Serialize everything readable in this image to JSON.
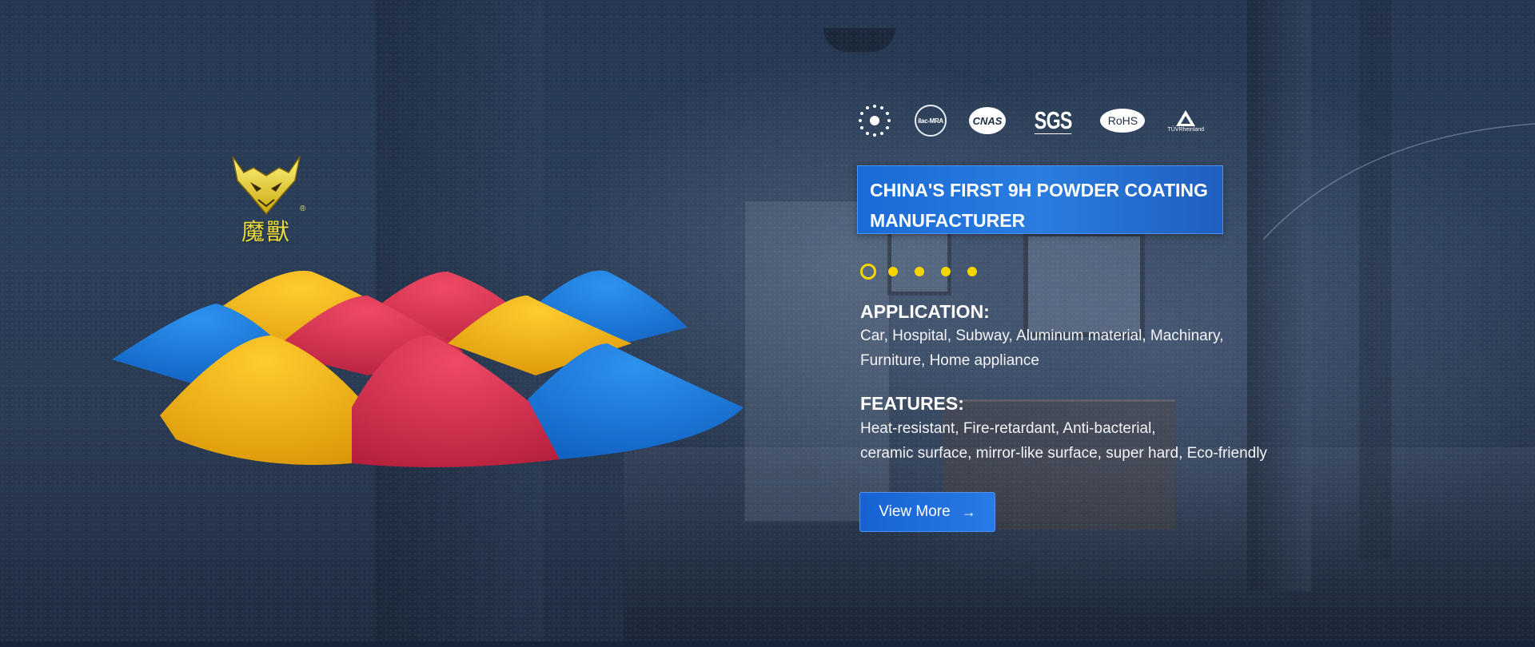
{
  "brand": {
    "chinese_name": "魔獸",
    "registered_mark": "®"
  },
  "certifications": [
    {
      "icon": "eu-stars-cert-icon",
      "label": ""
    },
    {
      "icon": "ilac-mra-cert-icon",
      "label": "ilac-MRA"
    },
    {
      "icon": "cnas-cert-icon",
      "label": "CNAS"
    },
    {
      "icon": "sgs-cert-icon",
      "label": "SGS"
    },
    {
      "icon": "rohs-cert-icon",
      "label": "RoHS"
    },
    {
      "icon": "tuv-cert-icon",
      "label": "TÜVRheinland"
    }
  ],
  "slide": {
    "title_line1": "CHINA'S FIRST 9H POWDER COATING",
    "title_line2": "MANUFACTURER",
    "total": 5,
    "active_index": 0
  },
  "application": {
    "heading": "APPLICATION:",
    "line1": "Car, Hospital, Subway, Aluminum material, Machinary,",
    "line2": "Furniture, Home appliance"
  },
  "features": {
    "heading": "FEATURES:",
    "line1": "Heat-resistant, Fire-retardant, Anti-bacterial,",
    "line2": "ceramic surface, mirror-like surface, super hard, Eco-friendly"
  },
  "cta": {
    "label": "View More",
    "arrow": "→"
  },
  "colors": {
    "accent_blue": "#1a6bd6",
    "dot_yellow": "#f5d500",
    "powder_yellow": "#f2b315",
    "powder_red": "#d8304f",
    "powder_blue": "#1b7fe0",
    "logo_gold": "#e8d93a"
  }
}
